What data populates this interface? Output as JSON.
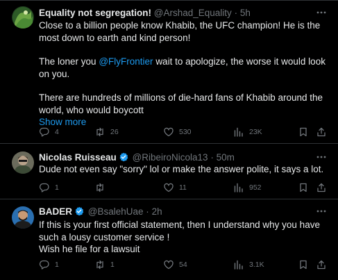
{
  "tweets": [
    {
      "display_name": "Equality not segregation!",
      "handle": "@Arshad_Equality",
      "sep": "·",
      "time": "5h",
      "verified": false,
      "paragraphs": [
        "Close to a billion people know Khabib, the UFC champion! He is the most down to earth and kind person!",
        "wait to apologize, the worse it would look on you.",
        "There are hundreds of millions of die-hard fans of Khabib around the world, who would boycott"
      ],
      "para2_prefix": "The loner you",
      "mention": "@FlyFrontier",
      "show_more": "Show more",
      "replies": "4",
      "reposts": "26",
      "likes": "530",
      "views": "23K"
    },
    {
      "display_name": "Nicolas Ruisseau",
      "handle": "@RibeiroNicola13",
      "sep": "·",
      "time": "50m",
      "verified": true,
      "text": "Dude not even say \"sorry\" lol or make the answer polite, it says a lot.",
      "replies": "1",
      "reposts": "",
      "likes": "11",
      "views": "952"
    },
    {
      "display_name": "BADER",
      "handle": "@BsalehUae",
      "sep": "·",
      "time": "2h",
      "verified": true,
      "lines": [
        "If this is your first official statement, then I understand why you have such a lousy customer service !",
        "Wish he file for a lawsuit"
      ],
      "replies": "1",
      "reposts": "1",
      "likes": "54",
      "views": "3.1K"
    }
  ],
  "colors": {
    "background": "#000000",
    "text": "#e7e9ea",
    "muted": "#71767b",
    "link": "#1d9bf0",
    "verified": "#1d9bf0",
    "divider": "#2f3336"
  }
}
